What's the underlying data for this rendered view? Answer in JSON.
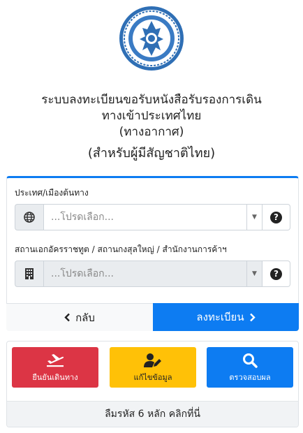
{
  "header": {
    "title_line1": "ระบบลงทะเบียนขอรับหนังสือรับรองการเดิน",
    "title_line2": "ทางเข้าประเทศไทย",
    "title_line3": "(ทางอากาศ)",
    "subtitle": "(สำหรับผู้มีสัญชาติไทย)"
  },
  "form": {
    "origin_label": "ประเทศ/เมืองต้นทาง",
    "origin_placeholder": "...โปรดเลือก...",
    "embassy_label": "สถานเอกอัครราชทูต / สถานกงสุลใหญ่ / สำนักงานการค้าฯ",
    "embassy_placeholder": "...โปรดเลือก...",
    "help_symbol": "?",
    "caret_symbol": "▼",
    "back_label": "กลับ",
    "register_label": "ลงทะเบียน"
  },
  "actions": {
    "confirm_label": "ยืนยันเดินทาง",
    "edit_label": "แก้ไขข้อมูล",
    "check_label": "ตรวจสอบผล",
    "forgot_code_label": "ลืมรหัส 6 หลัก คลิกที่นี่"
  },
  "colors": {
    "primary": "#0d7cf2",
    "danger": "#dc3545",
    "warning": "#ffc107",
    "seal_blue": "#2f6fb5"
  },
  "icons": {
    "origin": "globe-icon",
    "embassy": "building-icon",
    "help": "question-circle-icon",
    "back": "chevron-left-icon",
    "register": "chevron-right-icon",
    "confirm": "plane-departure-icon",
    "edit": "user-edit-icon",
    "check": "search-icon",
    "logo": "government-seal-logo"
  }
}
